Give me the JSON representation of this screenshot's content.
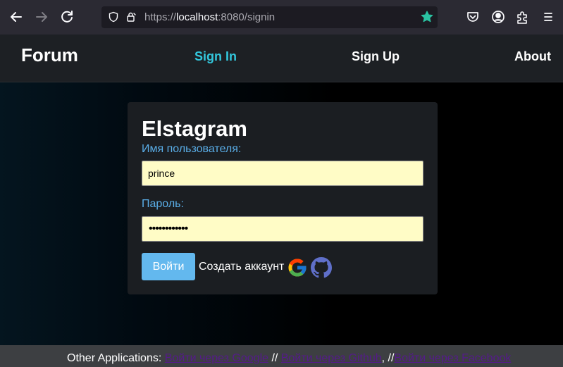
{
  "browser": {
    "url_prefix": "https://",
    "url_host": "localhost",
    "url_suffix": ":8080/signin"
  },
  "header": {
    "brand": "Forum",
    "nav": [
      {
        "label": "Sign In",
        "active": true
      },
      {
        "label": "Sign Up",
        "active": false
      },
      {
        "label": "About",
        "active": false
      }
    ]
  },
  "login": {
    "title": "Elstagram",
    "username_label": "Имя пользователя:",
    "username_value": "prince",
    "password_label": "Пароль:",
    "password_mask": "••••••••••••",
    "submit_label": "Войти",
    "register_label": "Создать аккаунт"
  },
  "footer": {
    "prefix": "Other Applications: ",
    "links": [
      "Войти через Google",
      "Войти через Github",
      "Войти через Facebook"
    ],
    "sep1": " // ",
    "sep2": ", //"
  },
  "colors": {
    "accent": "#33c7dd",
    "label": "#5aaee8",
    "button": "#63b8ee",
    "input_bg": "#fffcc6"
  }
}
